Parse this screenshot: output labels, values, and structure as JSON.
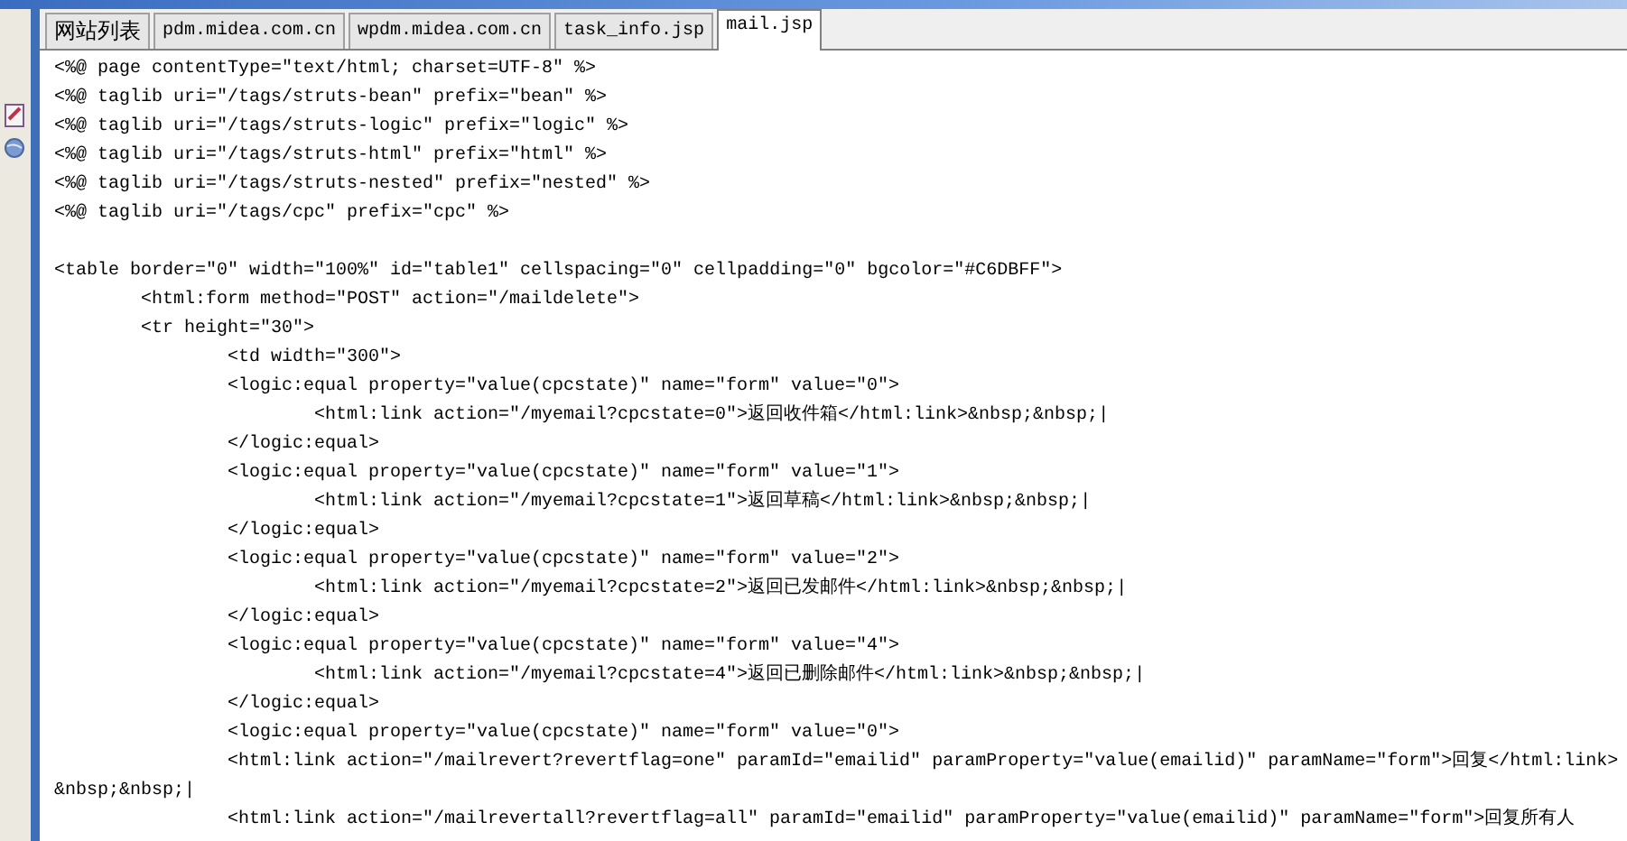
{
  "tabs": [
    {
      "label": "网站列表",
      "selected": false
    },
    {
      "label": "pdm.midea.com.cn",
      "selected": false
    },
    {
      "label": "wpdm.midea.com.cn",
      "selected": false
    },
    {
      "label": "task_info.jsp",
      "selected": false
    },
    {
      "label": "mail.jsp",
      "selected": true
    }
  ],
  "editor": {
    "lines": [
      {
        "kind": "code",
        "text": "<%@ page contentType=\"text/html; charset=UTF-8\" %>"
      },
      {
        "kind": "code",
        "text": "<%@ taglib uri=\"/tags/struts-bean\" prefix=\"bean\" %>"
      },
      {
        "kind": "code",
        "text": "<%@ taglib uri=\"/tags/struts-logic\" prefix=\"logic\" %>"
      },
      {
        "kind": "code",
        "text": "<%@ taglib uri=\"/tags/struts-html\" prefix=\"html\" %>"
      },
      {
        "kind": "code",
        "text": "<%@ taglib uri=\"/tags/struts-nested\" prefix=\"nested\" %>"
      },
      {
        "kind": "code",
        "text": "<%@ taglib uri=\"/tags/cpc\" prefix=\"cpc\" %>"
      },
      {
        "kind": "blank"
      },
      {
        "kind": "code",
        "text": "<table border=\"0\" width=\"100%\" id=\"table1\" cellspacing=\"0\" cellpadding=\"0\" bgcolor=\"#C6DBFF\">"
      },
      {
        "kind": "code",
        "text": "\t<html:form method=\"POST\" action=\"/maildelete\">"
      },
      {
        "kind": "code",
        "text": "\t<tr height=\"30\">"
      },
      {
        "kind": "code",
        "text": "\t\t<td width=\"300\">"
      },
      {
        "kind": "code",
        "text": "\t\t<logic:equal property=\"value(cpcstate)\" name=\"form\" value=\"0\">"
      },
      {
        "kind": "code",
        "text": "\t\t\t<html:link action=\"/myemail?cpcstate=0\">返回收件箱</html:link>&nbsp;&nbsp;|"
      },
      {
        "kind": "code",
        "text": "\t\t</logic:equal>"
      },
      {
        "kind": "code",
        "text": "\t\t<logic:equal property=\"value(cpcstate)\" name=\"form\" value=\"1\">"
      },
      {
        "kind": "code",
        "text": "\t\t\t<html:link action=\"/myemail?cpcstate=1\">返回草稿</html:link>&nbsp;&nbsp;|"
      },
      {
        "kind": "code",
        "text": "\t\t</logic:equal>"
      },
      {
        "kind": "code",
        "text": "\t\t<logic:equal property=\"value(cpcstate)\" name=\"form\" value=\"2\">"
      },
      {
        "kind": "code",
        "text": "\t\t\t<html:link action=\"/myemail?cpcstate=2\">返回已发邮件</html:link>&nbsp;&nbsp;|"
      },
      {
        "kind": "code",
        "text": "\t\t</logic:equal>"
      },
      {
        "kind": "code",
        "text": "\t\t<logic:equal property=\"value(cpcstate)\" name=\"form\" value=\"4\">"
      },
      {
        "kind": "code",
        "text": "\t\t\t<html:link action=\"/myemail?cpcstate=4\">返回已删除邮件</html:link>&nbsp;&nbsp;|"
      },
      {
        "kind": "code",
        "text": "\t\t</logic:equal>"
      },
      {
        "kind": "code",
        "text": "\t\t<logic:equal property=\"value(cpcstate)\" name=\"form\" value=\"0\">"
      },
      {
        "kind": "code",
        "text": "\t\t<html:link action=\"/mailrevert?revertflag=one\" paramId=\"emailid\" paramProperty=\"value(emailid)\" paramName=\"form\">回复</html:link>"
      },
      {
        "kind": "code",
        "text": "&nbsp;&nbsp;|"
      },
      {
        "kind": "code",
        "text": "\t\t<html:link action=\"/mailrevertall?revertflag=all\" paramId=\"emailid\" paramProperty=\"value(emailid)\" paramName=\"form\">回复所有人"
      }
    ]
  }
}
